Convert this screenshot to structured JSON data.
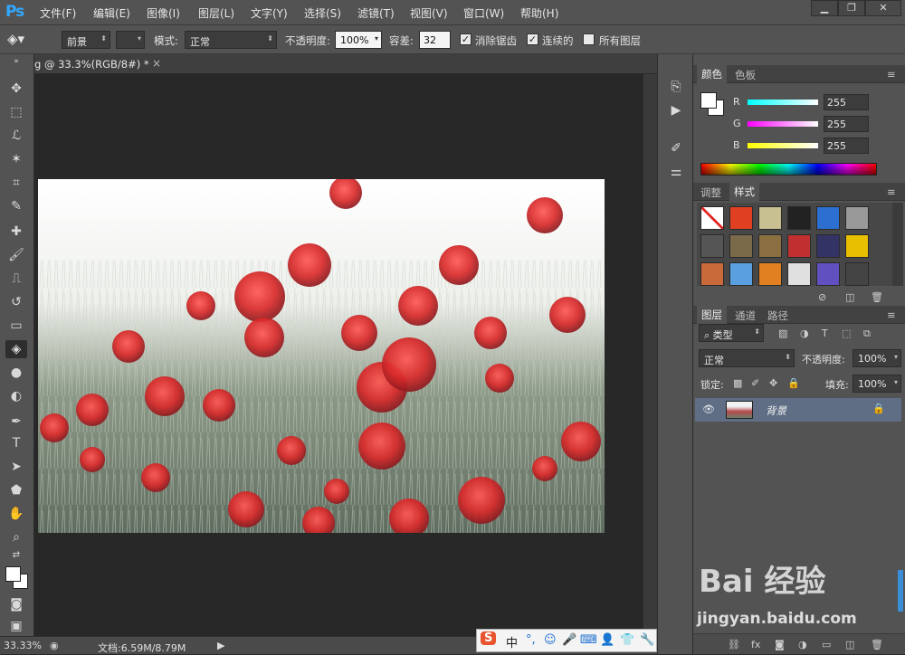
{
  "app": {
    "logo": "Ps"
  },
  "menu": [
    {
      "label": "文件(F)"
    },
    {
      "label": "编辑(E)"
    },
    {
      "label": "图像(I)"
    },
    {
      "label": "图层(L)"
    },
    {
      "label": "文字(Y)"
    },
    {
      "label": "选择(S)"
    },
    {
      "label": "滤镜(T)"
    },
    {
      "label": "视图(V)"
    },
    {
      "label": "窗口(W)"
    },
    {
      "label": "帮助(H)"
    }
  ],
  "window_controls": {
    "minimize": "▁",
    "restore": "❐",
    "close": "✕"
  },
  "options": {
    "fill_source": "前景",
    "mode_label": "模式:",
    "mode_value": "正常",
    "opacity_label": "不透明度:",
    "opacity_value": "100%",
    "tolerance_label": "容差:",
    "tolerance_value": "32",
    "antialias_label": "消除锯齿",
    "antialias_checked": true,
    "contiguous_label": "连续的",
    "contiguous_checked": true,
    "all_layers_label": "所有图层",
    "all_layers_checked": false
  },
  "document": {
    "tab_title": "g @ 33.3%(RGB/8#) *",
    "close": "×",
    "zoom": "33.33%",
    "info": "文档:6.59M/8.79M"
  },
  "tools": [
    {
      "name": "move-tool",
      "glyph": "✥"
    },
    {
      "name": "marquee-tool",
      "glyph": "⬚"
    },
    {
      "name": "lasso-tool",
      "glyph": "ℒ"
    },
    {
      "name": "magic-wand-tool",
      "glyph": "✶"
    },
    {
      "name": "crop-tool",
      "glyph": "⌗"
    },
    {
      "name": "eyedropper-tool",
      "glyph": "✎"
    },
    {
      "name": "healing-brush-tool",
      "glyph": "✚"
    },
    {
      "name": "brush-tool",
      "glyph": "🖌"
    },
    {
      "name": "clone-stamp-tool",
      "glyph": "⎍"
    },
    {
      "name": "history-brush-tool",
      "glyph": "↺"
    },
    {
      "name": "eraser-tool",
      "glyph": "▭"
    },
    {
      "name": "paint-bucket-tool",
      "glyph": "◈"
    },
    {
      "name": "blur-tool",
      "glyph": "●"
    },
    {
      "name": "dodge-tool",
      "glyph": "◐"
    },
    {
      "name": "pen-tool",
      "glyph": "✒"
    },
    {
      "name": "type-tool",
      "glyph": "T"
    },
    {
      "name": "path-selection-tool",
      "glyph": "➤"
    },
    {
      "name": "shape-tool",
      "glyph": "⬟"
    },
    {
      "name": "hand-tool",
      "glyph": "✋"
    },
    {
      "name": "zoom-tool",
      "glyph": "⌕"
    }
  ],
  "color_panel": {
    "tabs": [
      "颜色",
      "色板"
    ],
    "channels": [
      {
        "label": "R",
        "value": "255",
        "color": "#00ffff"
      },
      {
        "label": "G",
        "value": "255",
        "color": "#ff00ff"
      },
      {
        "label": "B",
        "value": "255",
        "color": "#ffff00"
      }
    ]
  },
  "styles_panel": {
    "tabs": [
      "调整",
      "样式"
    ]
  },
  "layers_panel": {
    "tabs": [
      "图层",
      "通道",
      "路径"
    ],
    "filter_kind": "类型",
    "blend_mode": "正常",
    "opacity_label": "不透明度:",
    "opacity_value": "100%",
    "lock_label": "锁定:",
    "fill_label": "填充:",
    "fill_value": "100%",
    "layers": [
      {
        "name": "背景",
        "visible": true,
        "locked": true
      }
    ]
  },
  "ime": {
    "items": [
      "S",
      "中",
      "°,",
      "☺",
      "🎤",
      "⌨",
      "👤",
      "👕",
      "🔧"
    ]
  },
  "watermark": {
    "brand": "Bai 经验",
    "url": "jingyan.baidu.com"
  },
  "colors": {
    "accent": "#31a8ff",
    "layer_selected": "#5f6e85",
    "panel": "#535353"
  }
}
